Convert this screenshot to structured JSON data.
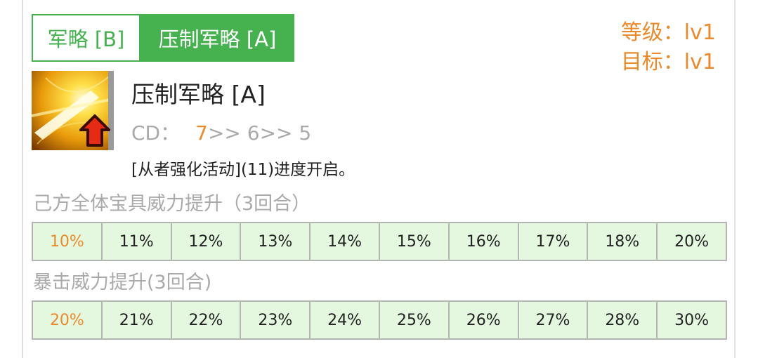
{
  "tabs": [
    {
      "label": "军略 [B]",
      "active": false
    },
    {
      "label": "压制军略 [A]",
      "active": true
    }
  ],
  "level": {
    "current": "等级：lv1",
    "target": "目标：lv1"
  },
  "skill": {
    "icon": "skill-upgrade-icon",
    "name": "压制军略 [A]",
    "cd_label": "CD：",
    "cd_current": "7",
    "cd_rest": ">> 6>> 5",
    "unlock_note": "[从者强化活动](11)进度开启。"
  },
  "effects": [
    {
      "title": "己方全体宝具威力提升（3回合）",
      "values": [
        "10%",
        "11%",
        "12%",
        "13%",
        "14%",
        "15%",
        "16%",
        "17%",
        "18%",
        "20%"
      ]
    },
    {
      "title": "暴击威力提升(3回合)",
      "values": [
        "20%",
        "21%",
        "22%",
        "23%",
        "24%",
        "25%",
        "26%",
        "27%",
        "28%",
        "30%"
      ]
    }
  ],
  "colors": {
    "accent": "#45b24f",
    "highlight": "#e98a2c",
    "table_bg": "#e4f8e0"
  }
}
